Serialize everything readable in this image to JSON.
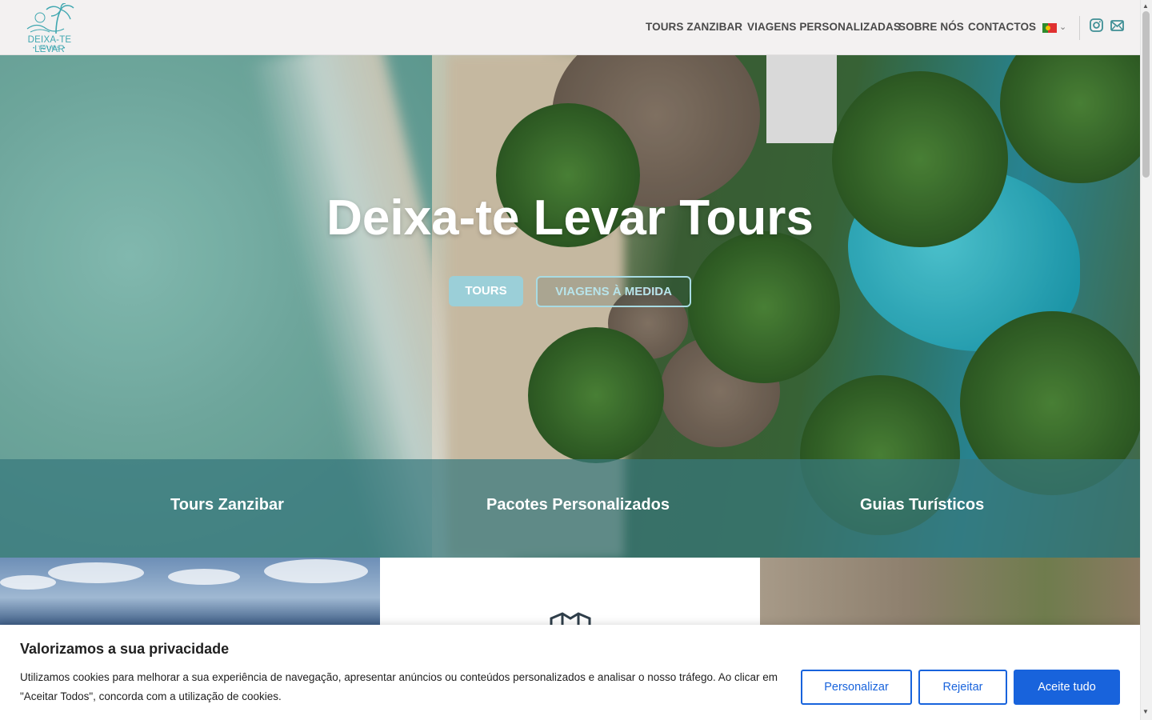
{
  "header": {
    "logo_text": "DEIXA-TE LEVAR",
    "logo_sub": "• TOURS •",
    "nav": [
      {
        "label": "TOURS ZANZIBAR"
      },
      {
        "label": "VIAGENS PERSONALIZADAS"
      },
      {
        "label": "SOBRE NÓS"
      },
      {
        "label": "CONTACTOS"
      }
    ],
    "language_icon": "portugal-flag-icon",
    "social_icons": [
      "instagram-icon",
      "mail-icon"
    ]
  },
  "hero": {
    "title": "Deixa-te Levar Tours",
    "primary_button": "TOURS",
    "secondary_button": "VIAGENS À MEDIDA",
    "categories": [
      "Tours Zanzibar",
      "Pacotes Personalizados",
      "Guias Turísticos"
    ]
  },
  "cards": {
    "middle_icon": "map-icon"
  },
  "cookie_banner": {
    "title": "Valorizamos a sua privacidade",
    "text": "Utilizamos cookies para melhorar a sua experiência de navegação, apresentar anúncios ou conteúdos personalizados e analisar o nosso tráfego. Ao clicar em \"Aceitar Todos\", concorda com a utilização de cookies.",
    "customize_label": "Personalizar",
    "reject_label": "Rejeitar",
    "accept_label": "Aceite tudo"
  },
  "colors": {
    "accent_teal": "#3fa7b0",
    "cookie_blue": "#1863dc",
    "band": "#37787d"
  }
}
